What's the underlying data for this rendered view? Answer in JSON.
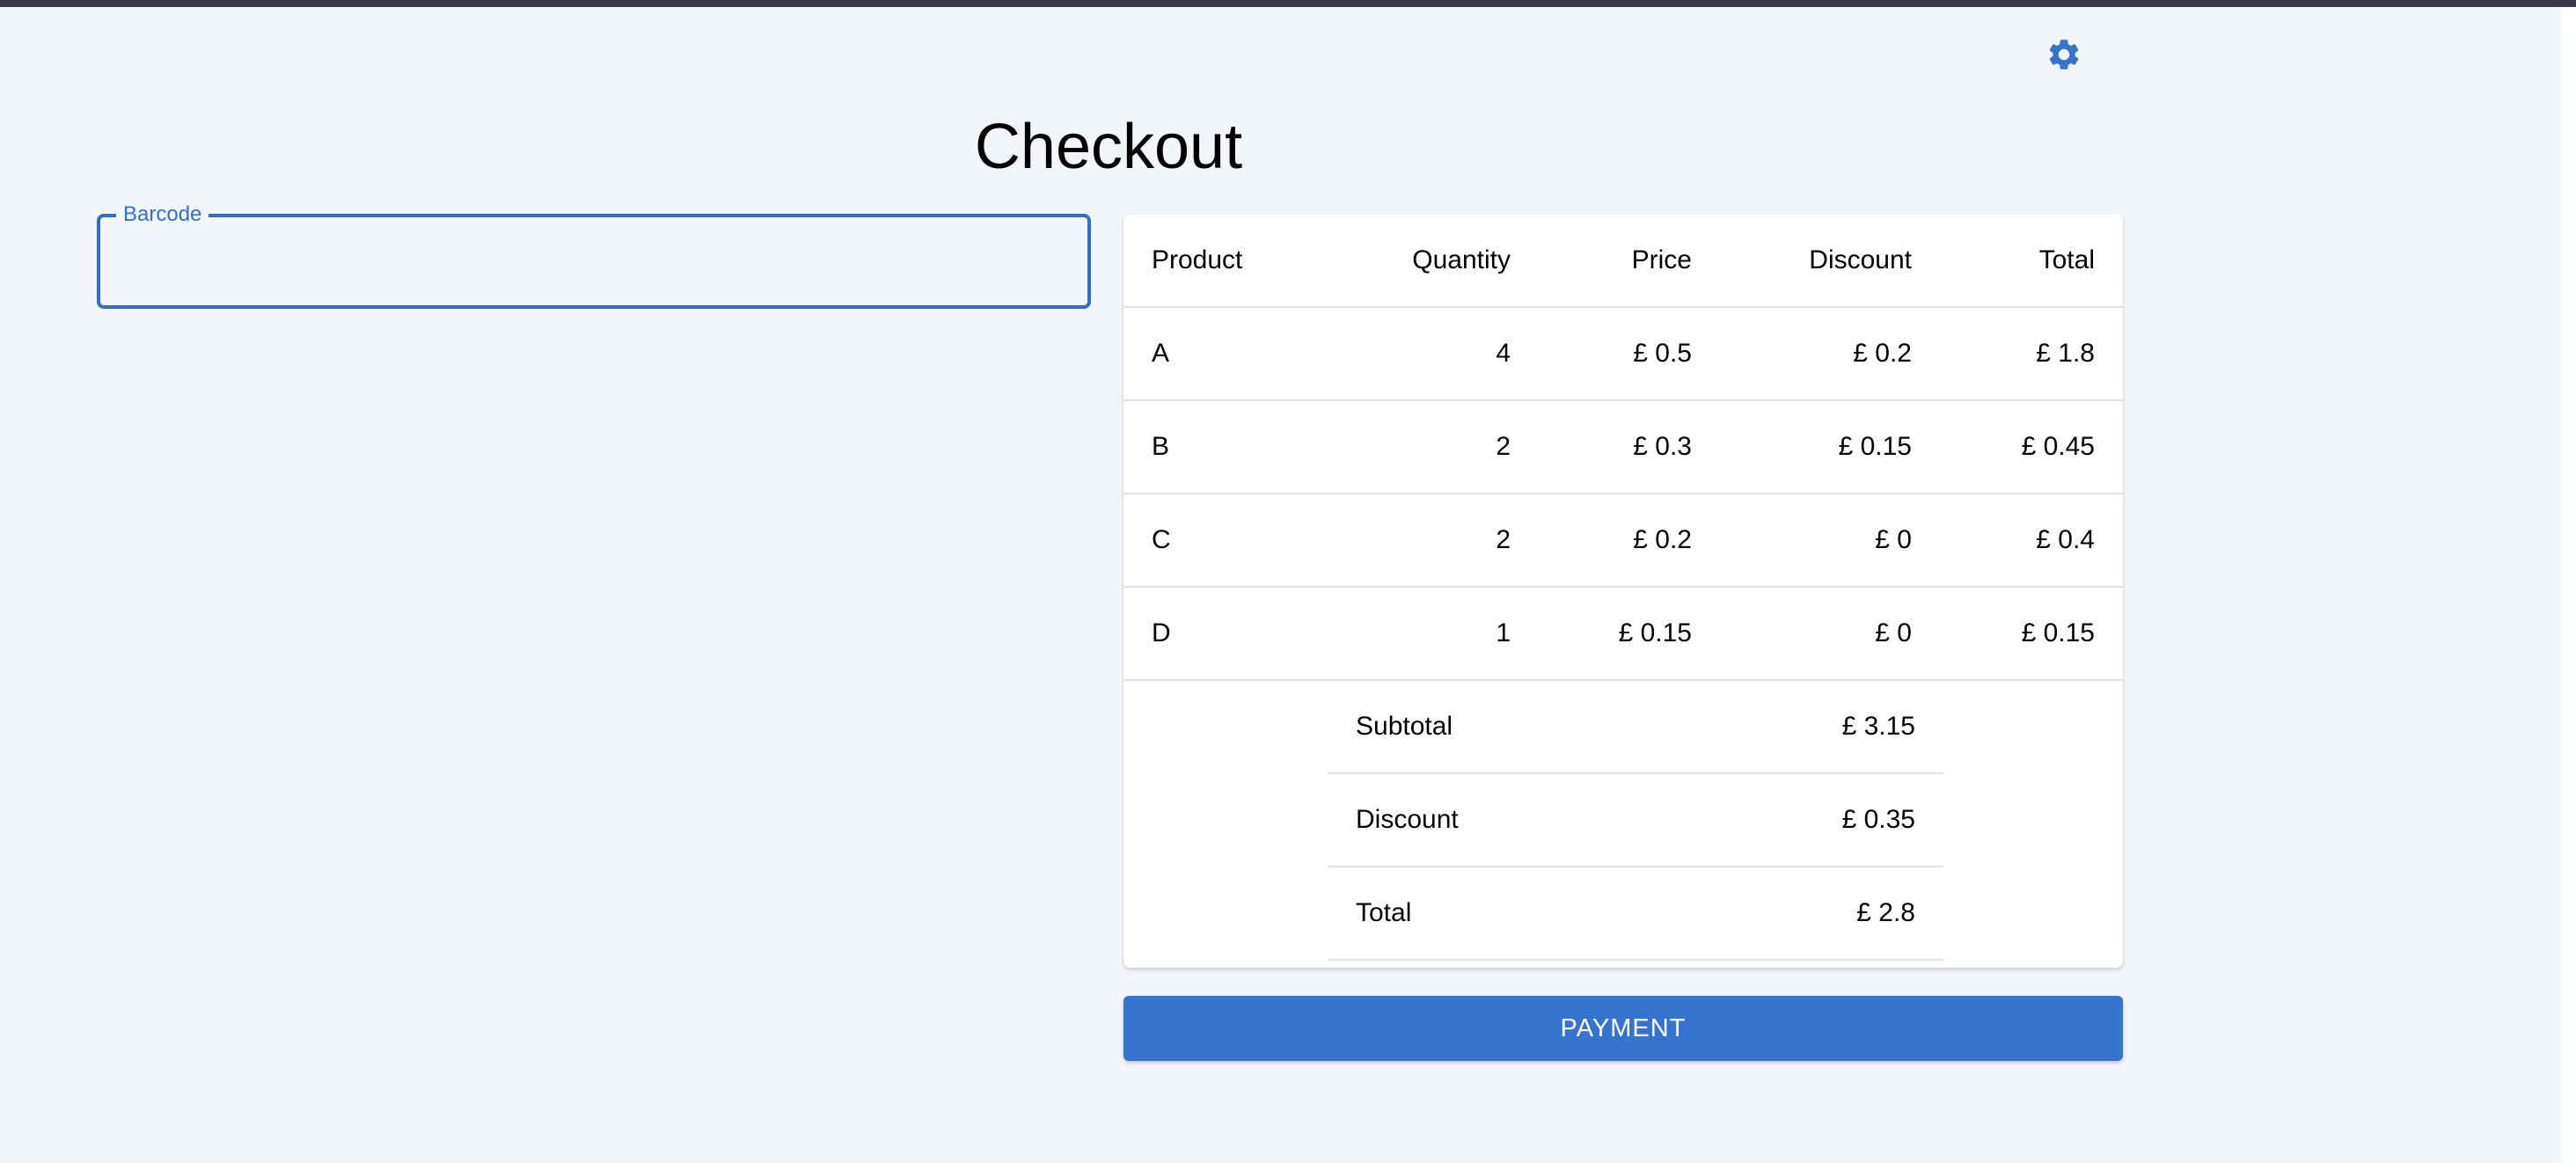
{
  "page": {
    "title": "Checkout",
    "settings_icon": "gear-icon",
    "accent_color": "#3574ce"
  },
  "barcode": {
    "label": "Barcode",
    "value": ""
  },
  "table": {
    "headers": [
      "Product",
      "Quantity",
      "Price",
      "Discount",
      "Total"
    ],
    "rows": [
      {
        "product": "A",
        "quantity": "4",
        "price": "£ 0.5",
        "discount": "£ 0.2",
        "total": "£ 1.8"
      },
      {
        "product": "B",
        "quantity": "2",
        "price": "£ 0.3",
        "discount": "£ 0.15",
        "total": "£ 0.45"
      },
      {
        "product": "C",
        "quantity": "2",
        "price": "£ 0.2",
        "discount": "£ 0",
        "total": "£ 0.4"
      },
      {
        "product": "D",
        "quantity": "1",
        "price": "£ 0.15",
        "discount": "£ 0",
        "total": "£ 0.15"
      }
    ]
  },
  "summary": {
    "subtotal_label": "Subtotal",
    "subtotal_value": "£ 3.15",
    "discount_label": "Discount",
    "discount_value": "£ 0.35",
    "total_label": "Total",
    "total_value": "£ 2.8"
  },
  "actions": {
    "payment_label": "PAYMENT"
  }
}
